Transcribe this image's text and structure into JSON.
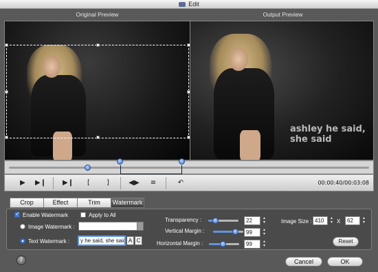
{
  "window": {
    "title": "Edit"
  },
  "previews": {
    "original_label": "Original Preview",
    "output_label": "Output Preview",
    "watermark_overlay": "ashley he said, she said"
  },
  "playback": {
    "time_display": "00:00:40/00:03:08",
    "icons": [
      "play-icon",
      "step-forward-icon",
      "snapshot-icon",
      "mark-in-icon",
      "mark-out-icon",
      "flip-horizontal-icon",
      "flip-vertical-icon",
      "undo-icon"
    ],
    "position": 0.22,
    "selection_start": 0.31,
    "selection_end": 0.48
  },
  "tabs": [
    {
      "label": "Crop",
      "active": false
    },
    {
      "label": "Effect",
      "active": false
    },
    {
      "label": "Trim",
      "active": false
    },
    {
      "label": "Watermark",
      "active": true
    }
  ],
  "watermark": {
    "enable_label": "Enable Watermark",
    "enable_checked": true,
    "apply_all_label": "Apply to All",
    "apply_all_checked": false,
    "image_label": "Image Watermark :",
    "image_value": "",
    "text_label": "Text Watermark :",
    "text_value": "y he said, she said",
    "font_button": "A",
    "color_button": "C",
    "selected_mode": "text"
  },
  "adjust": {
    "transparency_label": "Transparency :",
    "transparency_value": "22",
    "vertical_label": "Vertical Margin :",
    "vertical_value": "99",
    "horizontal_label": "Horizontal Margin :",
    "horizontal_value": "99"
  },
  "image_size": {
    "label": "Image Size :",
    "width": "410",
    "sep": "X",
    "height": "62",
    "reset_label": "Reset"
  },
  "footer": {
    "cancel_label": "Cancel",
    "ok_label": "OK",
    "help_glyph": "?"
  },
  "colors": {
    "accent": "#3e79d8",
    "window_bg": "#595959"
  }
}
